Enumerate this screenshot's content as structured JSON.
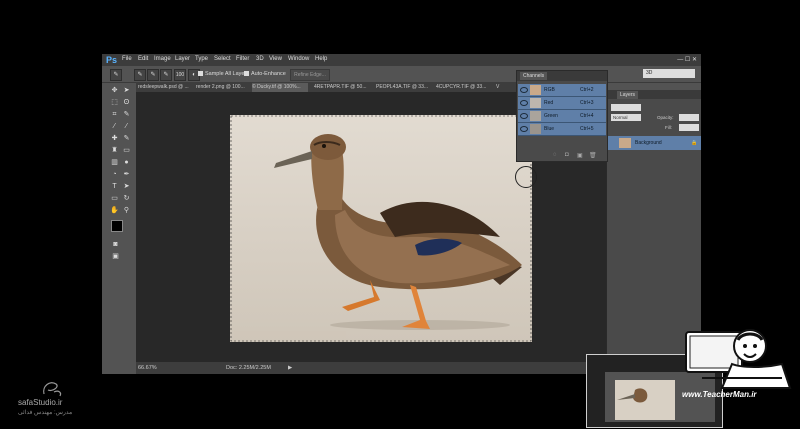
{
  "app": {
    "logo": "Ps",
    "menu": [
      "File",
      "Edit",
      "Image",
      "Layer",
      "Type",
      "Select",
      "Filter",
      "3D",
      "View",
      "Window",
      "Help"
    ],
    "window_controls": "— ☐ ✕"
  },
  "options_bar": {
    "brush_size": "100",
    "sample_all_layers": "Sample All Layers",
    "auto_enhance": "Auto-Enhance",
    "refine_edge": "Refine Edge...",
    "workspace": "3D"
  },
  "doc_tabs": [
    "redsleepwalk.psd @ ...",
    "render 2.png @ 100...",
    "© Ducky.tif @ 100%...",
    "4RETPAPR.TIF @ 50...",
    "PEOPL43A.TIF @ 33...",
    "4CUPCYR.TIF @ 33...",
    "V"
  ],
  "status": {
    "zoom": "66.67%",
    "doc": "Doc: 2.25M/2.25M"
  },
  "channels": {
    "title": "Channels",
    "rows": [
      {
        "name": "RGB",
        "key": "Ctrl+2"
      },
      {
        "name": "Red",
        "key": "Ctrl+3"
      },
      {
        "name": "Green",
        "key": "Ctrl+4"
      },
      {
        "name": "Blue",
        "key": "Ctrl+5"
      }
    ]
  },
  "layers": {
    "title": "Layers",
    "mode": "Normal",
    "opacity_label": "Opacity:",
    "fill_label": "Fill:",
    "layer_name": "Background"
  },
  "watermark": {
    "site": "safaStudio.ir",
    "credit_fa": "مدرس: مهندس فدائی",
    "brand_site": "www.TeacherMan.ir"
  },
  "colors": {
    "ps_blue": "#5ab4ff",
    "panel_selected": "#5f7fa8",
    "workspace_bg": "#282828"
  }
}
